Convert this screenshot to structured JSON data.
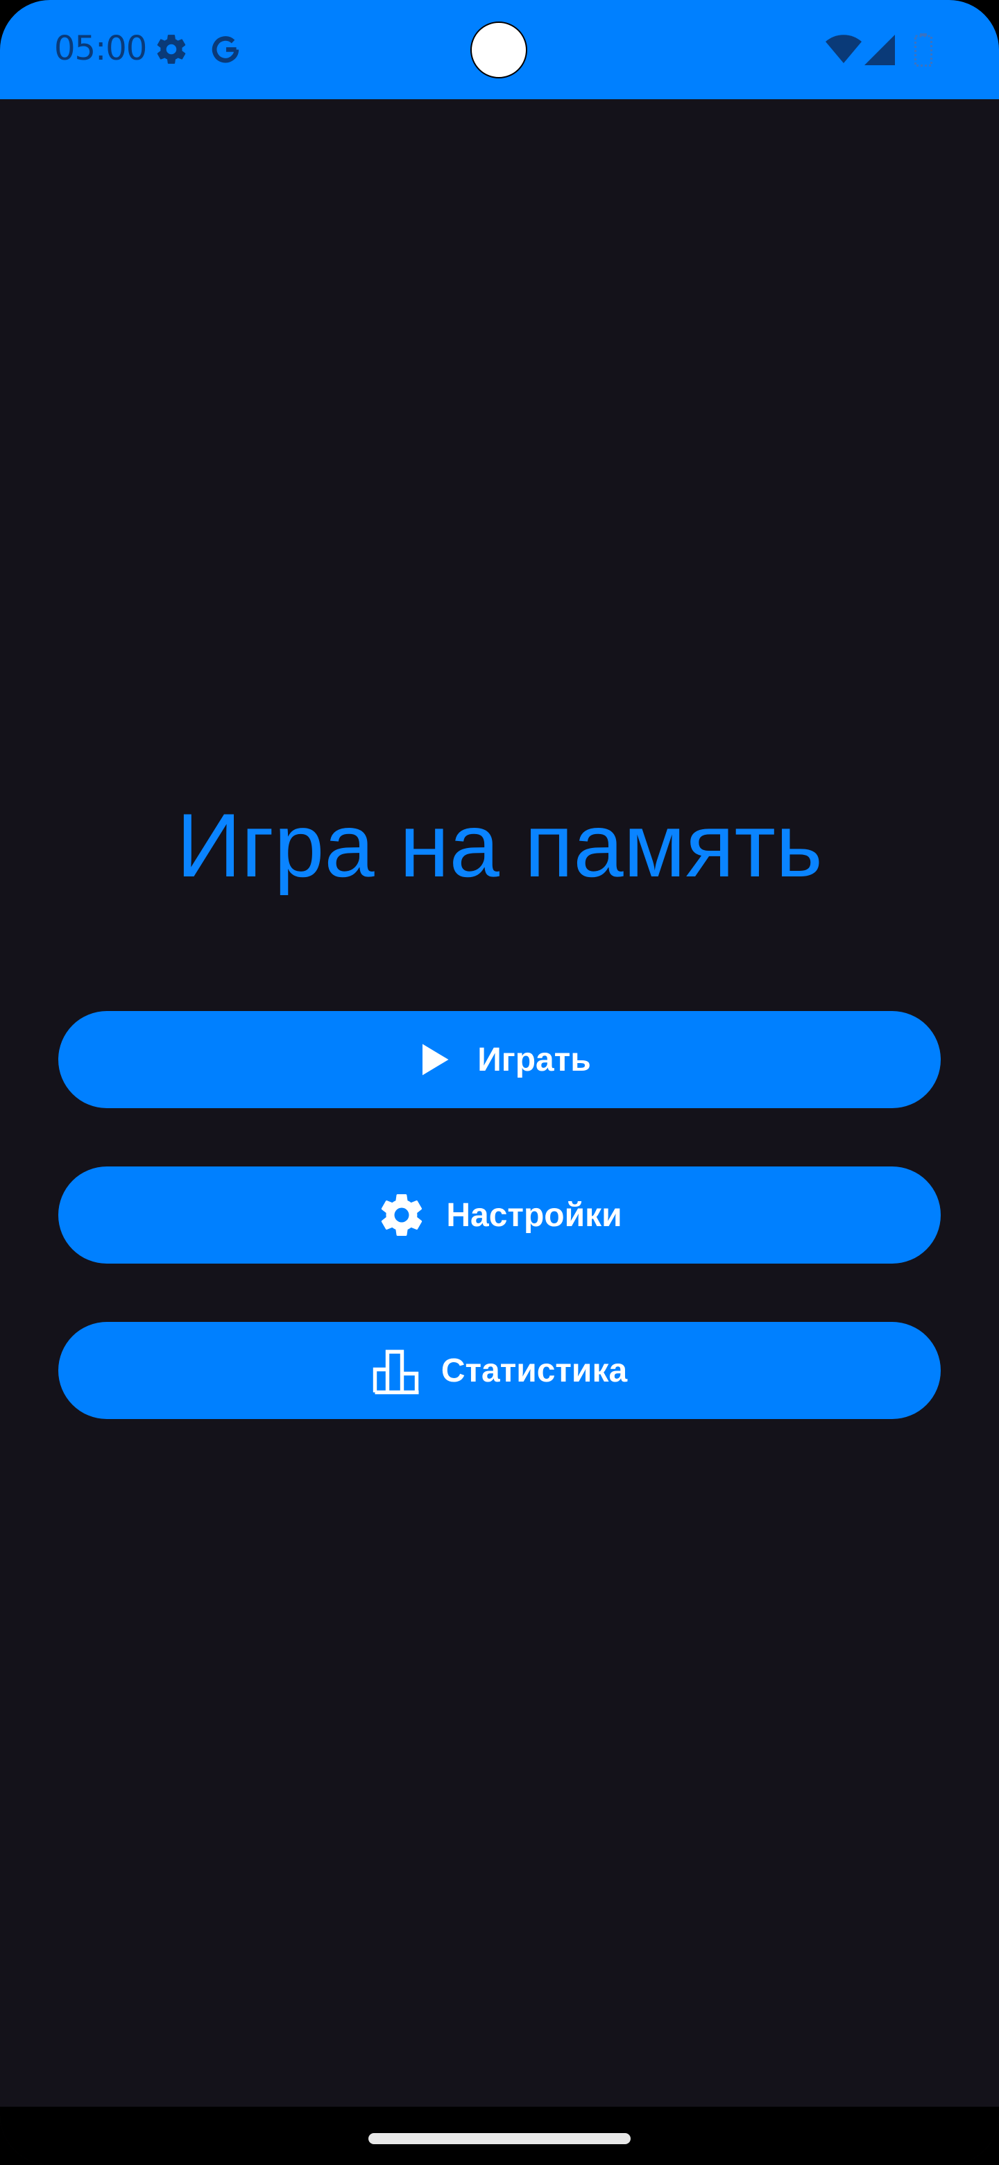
{
  "status_bar": {
    "time": "05:00",
    "icons": [
      "gear-icon",
      "google-g-icon",
      "wifi-icon",
      "cell-signal-icon",
      "battery-icon"
    ]
  },
  "app": {
    "title": "Игра на память"
  },
  "menu": {
    "buttons": [
      {
        "label": "Играть",
        "icon": "play-icon"
      },
      {
        "label": "Настройки",
        "icon": "settings-gear-icon"
      },
      {
        "label": "Статистика",
        "icon": "bar-chart-icon"
      }
    ]
  },
  "colors": {
    "accent": "#0080ff",
    "background": "#14121a",
    "title": "#0a84ff",
    "status_icons": "#0a3a78"
  }
}
